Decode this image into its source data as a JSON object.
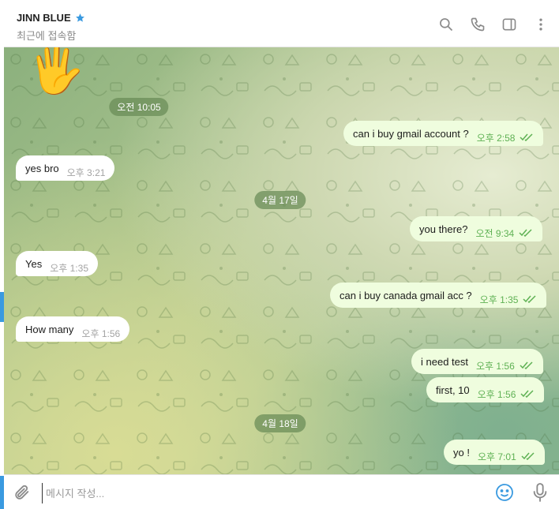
{
  "header": {
    "title": "JINN BLUE",
    "verified_icon": "star-icon",
    "status": "최근에 접속함",
    "icons": [
      "search-icon",
      "phone-icon",
      "sidebar-icon",
      "more-icon"
    ]
  },
  "dates": {
    "d1": "오전 10:05",
    "d2": "4월 17일",
    "d3": "4월 18일"
  },
  "messages": {
    "m1": {
      "text": "can i buy gmail account ?",
      "time": "오후 2:58"
    },
    "m2": {
      "text": "yes bro",
      "time": "오후 3:21"
    },
    "m3": {
      "text": "you there?",
      "time": "오전 9:34"
    },
    "m4": {
      "text": "Yes",
      "time": "오후 1:35"
    },
    "m5": {
      "text": "can i buy canada gmail acc ?",
      "time": "오후 1:35"
    },
    "m6": {
      "text": "How many",
      "time": "오후 1:56"
    },
    "m7": {
      "text": "i need test",
      "time": "오후 1:56"
    },
    "m8": {
      "text": "first, 10",
      "time": "오후 1:56"
    },
    "m9": {
      "text": "yo !",
      "time": "오후 7:01"
    }
  },
  "composer": {
    "placeholder": "메시지 작성..."
  },
  "colors": {
    "accent": "#3a9ae0",
    "outgoing_bubble": "#effdde",
    "check": "#5fb154"
  }
}
